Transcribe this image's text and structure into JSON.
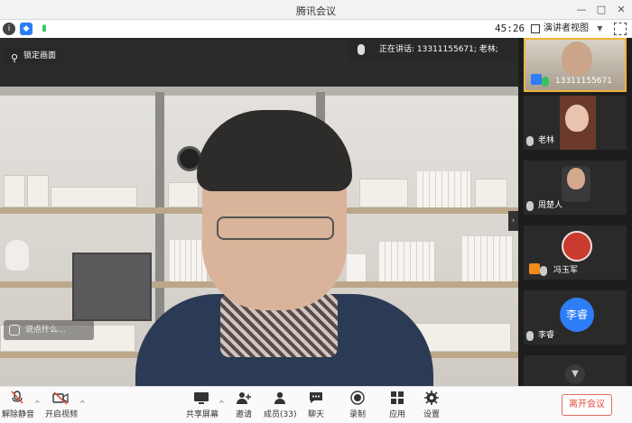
{
  "window": {
    "title": "腾讯会议"
  },
  "infobar": {
    "timer": "45:26",
    "view_mode": "演讲者视图"
  },
  "video": {
    "lock_label": "锁定画面",
    "speaking_text": "正在讲话: 13311155671; 老林;",
    "chat_placeholder": "说点什么..."
  },
  "participants": [
    {
      "name": "13311155671",
      "mic": "on",
      "host": true
    },
    {
      "name": "老林",
      "mic": "off"
    },
    {
      "name": "周楚人",
      "mic": "off"
    },
    {
      "name": "冯玉军",
      "mic": "off",
      "host": true
    },
    {
      "name": "李睿",
      "mic": "off",
      "avatar_text": "李睿"
    }
  ],
  "toolbar": {
    "unmute": "解除静音",
    "start_video": "开启视频",
    "share": "共享屏幕",
    "invite": "邀请",
    "members": "成员(33)",
    "chat": "聊天",
    "record": "录制",
    "apps": "应用",
    "settings": "设置",
    "leave": "离开会议"
  },
  "colors": {
    "accent": "#2d7df6",
    "leave": "#e04a3a",
    "active_border": "#f0b43a"
  }
}
